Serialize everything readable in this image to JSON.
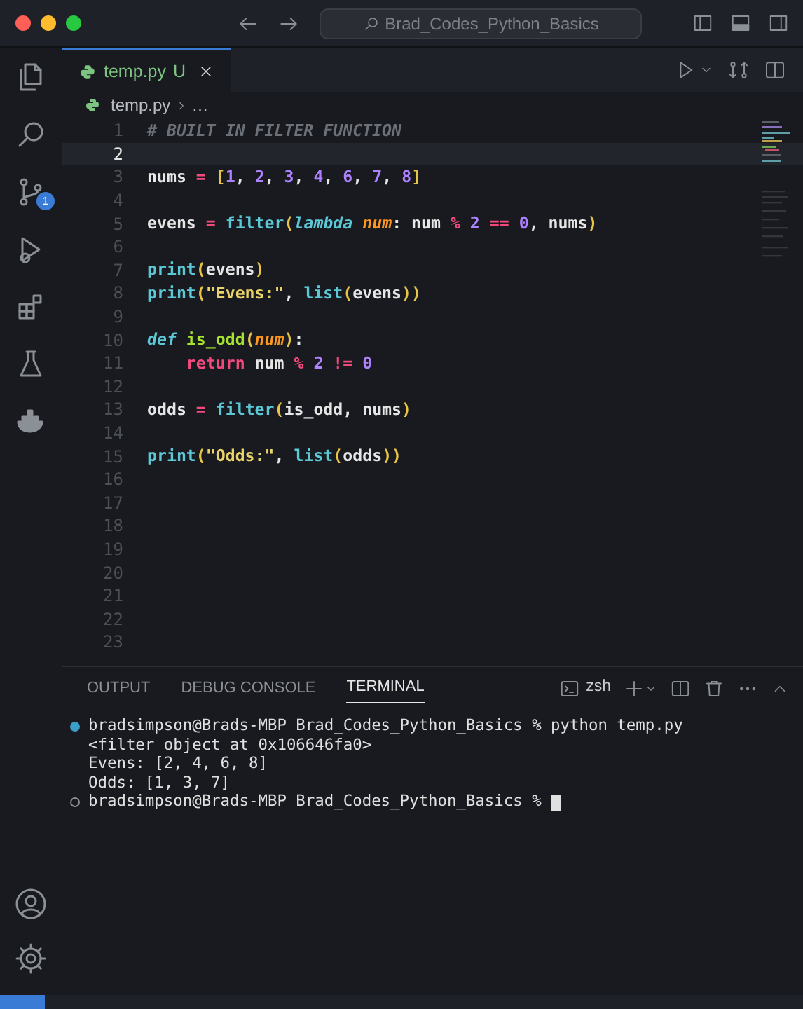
{
  "title_bar": {
    "search": "Brad_Codes_Python_Basics"
  },
  "activity_bar": [
    {
      "kind": "files",
      "selected": false
    },
    {
      "kind": "search",
      "selected": false
    },
    {
      "kind": "source-control",
      "selected": false,
      "badge": "1"
    },
    {
      "kind": "run",
      "selected": false
    },
    {
      "kind": "extensions",
      "selected": false
    },
    {
      "kind": "flask",
      "selected": false
    },
    {
      "kind": "docker",
      "selected": false
    }
  ],
  "activity_bottom": [
    {
      "kind": "account"
    },
    {
      "kind": "settings"
    }
  ],
  "tabs": [
    {
      "label": "temp.py",
      "status": "U",
      "selected": true
    }
  ],
  "breadcrumb": [
    "temp.py",
    "…"
  ],
  "editor": {
    "lines": [
      {
        "number": "1",
        "current": false,
        "tokens": [
          {
            "kind": "comment",
            "text": "# BUILT IN FILTER FUNCTION"
          }
        ]
      },
      {
        "number": "2",
        "current": true
      },
      {
        "number": "3",
        "current": false,
        "tokens": [
          {
            "kind": "name",
            "text": "nums "
          },
          {
            "kind": "op",
            "text": "= "
          },
          {
            "kind": "bracket",
            "text": "["
          },
          {
            "kind": "num",
            "text": "1"
          },
          {
            "kind": "name",
            "text": ", "
          },
          {
            "kind": "num",
            "text": "2"
          },
          {
            "kind": "name",
            "text": ", "
          },
          {
            "kind": "num",
            "text": "3"
          },
          {
            "kind": "name",
            "text": ", "
          },
          {
            "kind": "num",
            "text": "4"
          },
          {
            "kind": "name",
            "text": ", "
          },
          {
            "kind": "num",
            "text": "6"
          },
          {
            "kind": "name",
            "text": ", "
          },
          {
            "kind": "num",
            "text": "7"
          },
          {
            "kind": "name",
            "text": ", "
          },
          {
            "kind": "num",
            "text": "8"
          },
          {
            "kind": "bracket",
            "text": "]"
          }
        ]
      },
      {
        "number": "4",
        "current": false
      },
      {
        "number": "5",
        "current": false,
        "tokens": [
          {
            "kind": "name",
            "text": "evens "
          },
          {
            "kind": "op",
            "text": "= "
          },
          {
            "kind": "builtin",
            "text": "filter"
          },
          {
            "kind": "bracket",
            "text": "("
          },
          {
            "kind": "keyword",
            "text": "lambda "
          },
          {
            "kind": "param",
            "text": "num"
          },
          {
            "kind": "name",
            "text": ": num "
          },
          {
            "kind": "op",
            "text": "% "
          },
          {
            "kind": "num",
            "text": "2 "
          },
          {
            "kind": "op",
            "text": "== "
          },
          {
            "kind": "num",
            "text": "0"
          },
          {
            "kind": "name",
            "text": ", nums"
          },
          {
            "kind": "bracket",
            "text": ")"
          }
        ]
      },
      {
        "number": "6",
        "current": false
      },
      {
        "number": "7",
        "current": false,
        "tokens": [
          {
            "kind": "builtin",
            "text": "print"
          },
          {
            "kind": "bracket",
            "text": "("
          },
          {
            "kind": "name",
            "text": "evens"
          },
          {
            "kind": "bracket",
            "text": ")"
          }
        ]
      },
      {
        "number": "8",
        "current": false,
        "tokens": [
          {
            "kind": "builtin",
            "text": "print"
          },
          {
            "kind": "bracket",
            "text": "("
          },
          {
            "kind": "string",
            "text": "\"Evens:\""
          },
          {
            "kind": "name",
            "text": ", "
          },
          {
            "kind": "builtin",
            "text": "list"
          },
          {
            "kind": "bracket",
            "text": "("
          },
          {
            "kind": "name",
            "text": "evens"
          },
          {
            "kind": "bracket",
            "text": "))"
          }
        ]
      },
      {
        "number": "9",
        "current": false
      },
      {
        "number": "10",
        "current": false,
        "tokens": [
          {
            "kind": "keyword",
            "text": "def "
          },
          {
            "kind": "func",
            "text": "is_odd"
          },
          {
            "kind": "bracket",
            "text": "("
          },
          {
            "kind": "param",
            "text": "num"
          },
          {
            "kind": "bracket",
            "text": ")"
          },
          {
            "kind": "name",
            "text": ":"
          }
        ]
      },
      {
        "number": "11",
        "current": false,
        "tokens": [
          {
            "kind": "ret",
            "text": "    return"
          },
          {
            "kind": "name",
            "text": " num "
          },
          {
            "kind": "op",
            "text": "% "
          },
          {
            "kind": "num",
            "text": "2 "
          },
          {
            "kind": "op",
            "text": "!= "
          },
          {
            "kind": "num",
            "text": "0"
          }
        ]
      },
      {
        "number": "12",
        "current": false
      },
      {
        "number": "13",
        "current": false,
        "tokens": [
          {
            "kind": "name",
            "text": "odds "
          },
          {
            "kind": "op",
            "text": "= "
          },
          {
            "kind": "builtin",
            "text": "filter"
          },
          {
            "kind": "bracket",
            "text": "("
          },
          {
            "kind": "name",
            "text": "is_odd, nums"
          },
          {
            "kind": "bracket",
            "text": ")"
          }
        ]
      },
      {
        "number": "14",
        "current": false
      },
      {
        "number": "15",
        "current": false,
        "tokens": [
          {
            "kind": "builtin",
            "text": "print"
          },
          {
            "kind": "bracket",
            "text": "("
          },
          {
            "kind": "string",
            "text": "\"Odds:\""
          },
          {
            "kind": "name",
            "text": ", "
          },
          {
            "kind": "builtin",
            "text": "list"
          },
          {
            "kind": "bracket",
            "text": "("
          },
          {
            "kind": "name",
            "text": "odds"
          },
          {
            "kind": "bracket",
            "text": "))"
          }
        ]
      },
      {
        "number": "16",
        "current": false
      },
      {
        "number": "17",
        "current": false
      },
      {
        "number": "18",
        "current": false
      },
      {
        "number": "19",
        "current": false
      },
      {
        "number": "20",
        "current": false
      },
      {
        "number": "21",
        "current": false
      },
      {
        "number": "22",
        "current": false
      },
      {
        "number": "23",
        "current": false
      }
    ]
  },
  "panel": {
    "tabs": [
      {
        "label": "OUTPUT",
        "selected": false
      },
      {
        "label": "DEBUG CONSOLE",
        "selected": false
      },
      {
        "label": "TERMINAL",
        "selected": true
      }
    ],
    "shell": "zsh",
    "terminal": [
      {
        "kind": "command",
        "text": "bradsimpson@Brads-MBP Brad_Codes_Python_Basics % python temp.py"
      },
      {
        "kind": "output",
        "text": "<filter object at 0x106646fa0>"
      },
      {
        "kind": "output",
        "text": "Evens: [2, 4, 6, 8]"
      },
      {
        "kind": "output",
        "text": "Odds: [1, 3, 7]"
      },
      {
        "kind": "prompt",
        "text": "bradsimpson@Brads-MBP Brad_Codes_Python_Basics %"
      }
    ]
  }
}
